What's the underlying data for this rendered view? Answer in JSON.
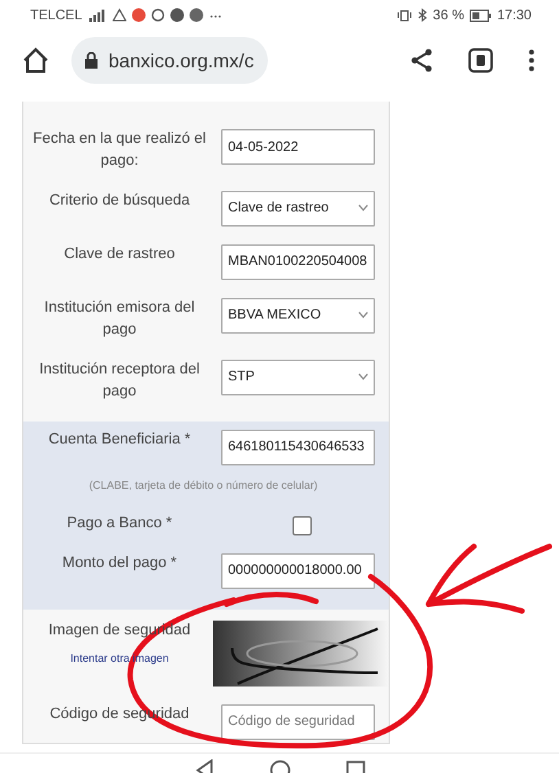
{
  "status_bar": {
    "carrier": "TELCEL",
    "battery": "36 %",
    "time": "17:30"
  },
  "browser": {
    "url": "banxico.org.mx/c"
  },
  "form": {
    "sections": [
      {
        "highlighted": false,
        "fields": [
          {
            "kind": "text",
            "label": "Fecha en la que realizó el pago:",
            "value": "04-05-2022"
          },
          {
            "kind": "select",
            "label": "Criterio de búsqueda",
            "value": "Clave de rastreo"
          },
          {
            "kind": "text",
            "label": "Clave de rastreo",
            "value": "MBAN0100220504008"
          },
          {
            "kind": "select",
            "label": "Institución emisora del pago",
            "value": "BBVA MEXICO"
          },
          {
            "kind": "select",
            "label": "Institución receptora del pago",
            "value": "STP"
          }
        ]
      },
      {
        "highlighted": true,
        "fields": [
          {
            "kind": "text",
            "label": "Cuenta Beneficiaria *",
            "value": "646180115430646533"
          },
          {
            "kind": "hint",
            "label": "(CLABE, tarjeta de débito o número de celular)"
          },
          {
            "kind": "checkbox",
            "label": "Pago a Banco *",
            "checked": false
          },
          {
            "kind": "text",
            "label": "Monto del pago *",
            "value": "000000000018000.00"
          }
        ]
      },
      {
        "highlighted": false,
        "fields": [
          {
            "kind": "captcha",
            "label": "Imagen de seguridad",
            "link": "Intentar otra imagen"
          },
          {
            "kind": "text",
            "label": "Código de seguridad",
            "placeholder": "Código de seguridad"
          }
        ]
      }
    ]
  }
}
